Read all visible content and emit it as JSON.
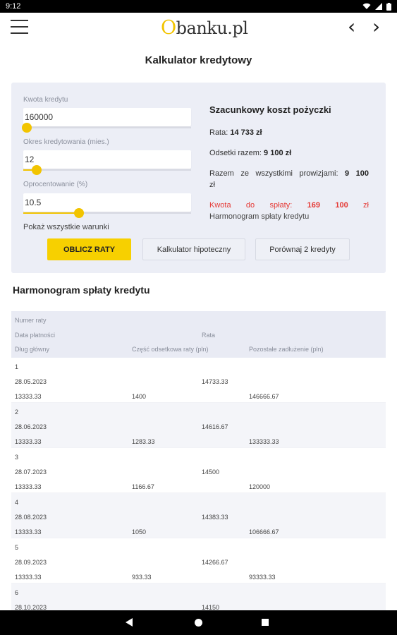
{
  "status": {
    "time": "9:12",
    "icons": [
      "wifi-icon",
      "signal-icon",
      "battery-icon"
    ]
  },
  "appbar": {
    "logo_o": "O",
    "logo_rest": "banku.pl",
    "back_arrow": "‹",
    "forward_arrow": "›"
  },
  "page_title": "Kalkulator kredytowy",
  "calculator": {
    "amount_label": "Kwota kredytu",
    "amount_value": "160000",
    "amount_slider_fraction": 0.0,
    "period_label": "Okres kredytowania (mies.)",
    "period_value": "12",
    "period_slider_fraction": 0.06,
    "rate_label": "Oprocentowanie (%)",
    "rate_value": "10.5",
    "rate_slider_fraction": 0.31,
    "show_all_label": "Pokaż wszystkie warunki",
    "btn_calculate": "OBLICZ RATY",
    "btn_mortgage": "Kalkulator hipoteczny",
    "btn_compare": "Porównaj 2 kredyty",
    "accent_color": "#f7d000"
  },
  "summary": {
    "title": "Szacunkowy koszt pożyczki",
    "rate_label": "Rata:",
    "rate_value": "14 733 zł",
    "interest_label": "Odsetki razem:",
    "interest_value": "9 100 zł",
    "total_label": "Razem ze wszystkimi prowizjami:",
    "total_value": "9 100",
    "total_unit": "zł",
    "repay_label": "Kwota do spłaty:",
    "repay_value": "169 100",
    "repay_unit": "zł",
    "schedule_link": "Harmonogram spłaty kredytu",
    "highlight_color": "#e53935"
  },
  "schedule": {
    "title": "Harmonogram spłaty kredytu",
    "headers": {
      "number": "Numer raty",
      "date": "Data płatności",
      "installment": "Rata",
      "principal": "Dług główny",
      "interest": "Część odsetkowa raty (pln)",
      "remaining": "Pozostałe zadłużenie (pln)"
    },
    "rows": [
      {
        "number": "1",
        "date": "28.05.2023",
        "installment": "14733.33",
        "principal": "13333.33",
        "interest": "1400",
        "remaining": "146666.67"
      },
      {
        "number": "2",
        "date": "28.06.2023",
        "installment": "14616.67",
        "principal": "13333.33",
        "interest": "1283.33",
        "remaining": "133333.33"
      },
      {
        "number": "3",
        "date": "28.07.2023",
        "installment": "14500",
        "principal": "13333.33",
        "interest": "1166.67",
        "remaining": "120000"
      },
      {
        "number": "4",
        "date": "28.08.2023",
        "installment": "14383.33",
        "principal": "13333.33",
        "interest": "1050",
        "remaining": "106666.67"
      },
      {
        "number": "5",
        "date": "28.09.2023",
        "installment": "14266.67",
        "principal": "13333.33",
        "interest": "933.33",
        "remaining": "93333.33"
      },
      {
        "number": "6",
        "date": "28.10.2023",
        "installment": "14150",
        "principal": "",
        "interest": "",
        "remaining": ""
      }
    ]
  }
}
